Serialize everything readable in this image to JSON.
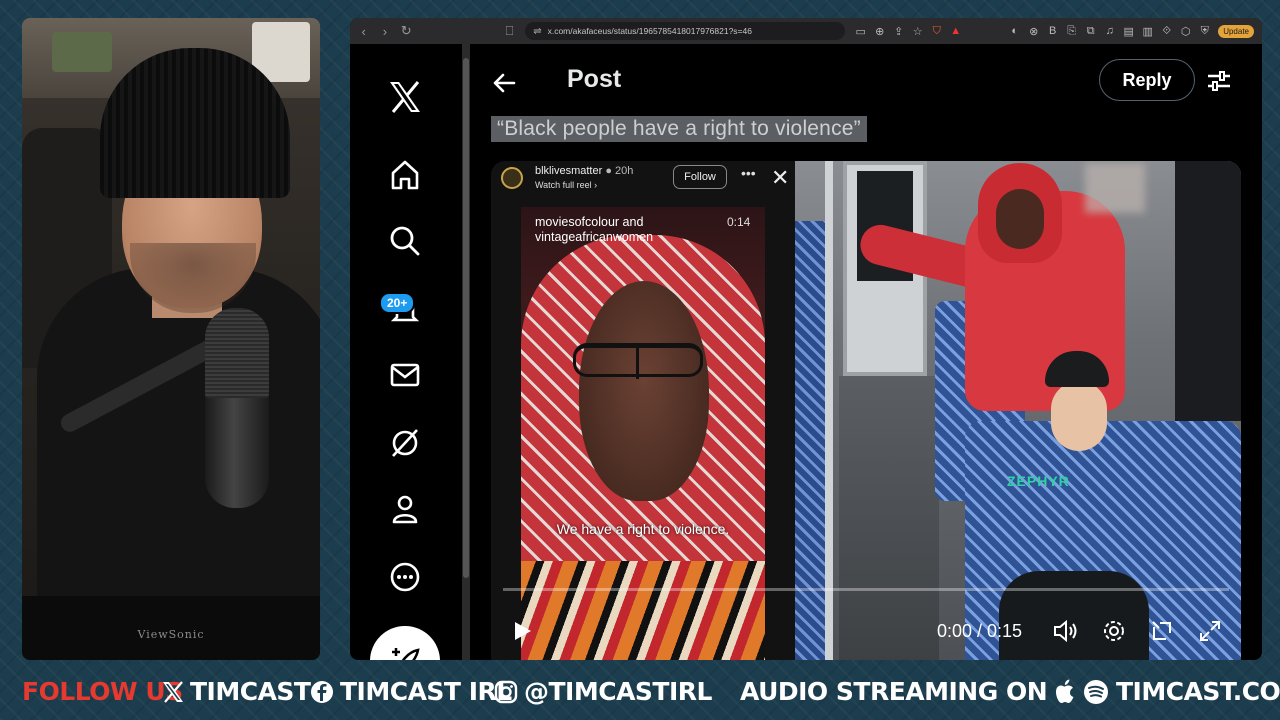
{
  "browser": {
    "url": "x.com/akafaceus/status/1965785418017976821?s=46",
    "update_label": "Update"
  },
  "sidebar": {
    "notifications_badge": "20+"
  },
  "post": {
    "header_title": "Post",
    "reply_label": "Reply",
    "quote_text": "“Black people have a right to violence”"
  },
  "reel": {
    "username": "blklivesmatter",
    "age": "20h",
    "watch_label": "Watch full reel ›",
    "follow_label": "Follow",
    "caption": "moviesofcolour and vintageafricanwomen",
    "duration": "0:14",
    "subtitle": "We have a right to violence."
  },
  "video": {
    "time_display": "0:00 / 0:15",
    "shirt_text": "ZEPHYR"
  },
  "banner": {
    "follow_us": "FOLLOW US",
    "x_handle": "TIMCAST",
    "fb_handle": "TIMCAST IRL",
    "ig_handle": "@TIMCASTIRL",
    "audio": "AUDIO STREAMING ON",
    "site": "TIMCAST.COM"
  },
  "webcam": {
    "monitor_brand": "ViewSonic"
  },
  "colors": {
    "x_background": "#000000",
    "x_blue": "#1d9bf0",
    "banner_red": "#e6392f",
    "banner_text": "#ffffff"
  }
}
